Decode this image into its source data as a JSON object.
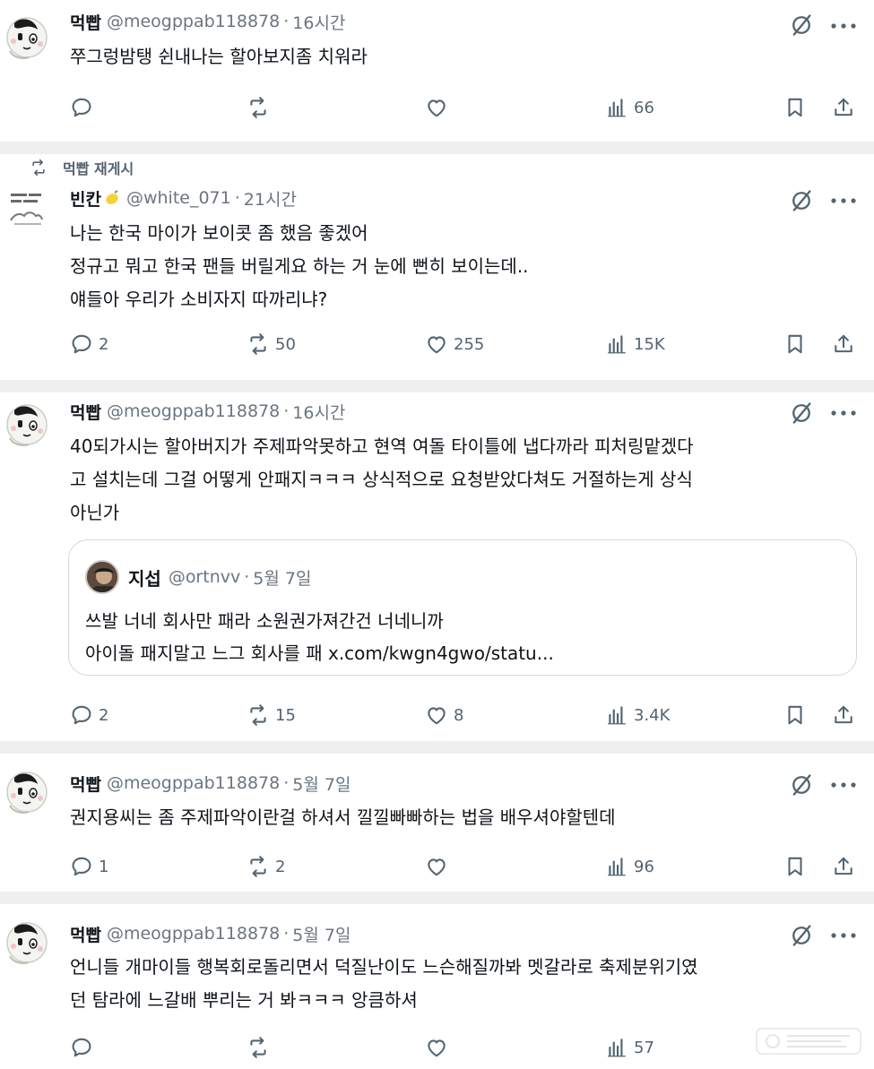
{
  "icons": {
    "reply": "reply-bubble-icon",
    "repost": "repost-arrows-icon",
    "like": "heart-icon",
    "views": "bar-chart-icon",
    "bookmark": "bookmark-icon",
    "share": "share-upload-icon",
    "grok": "grok-slash-icon",
    "more": "ellipsis-icon"
  },
  "colors": {
    "text": "#0f1419",
    "muted": "#536471",
    "separator": "#efefef",
    "quote_border": "#d3d7db"
  },
  "posts": [
    {
      "name": "먹빱",
      "handle": "@meogppab118878",
      "dot": "·",
      "time": "16시간",
      "lines": [
        "쭈그렁밤탱 쉰내나는 할아보지좀 치워라"
      ],
      "replies": "",
      "reposts": "",
      "likes": "",
      "views": "66"
    },
    {
      "repost_label": "먹빱 재게시",
      "name": "빈칸",
      "handle": "@white_071",
      "dot": "·",
      "time": "21시간",
      "lines": [
        "나는 한국 마이가 보이콧 좀 했음 좋겠어",
        "정규고 뭐고 한국 팬들 버릴게요 하는 거 눈에 뻔히 보이는데..",
        "얘들아 우리가 소비자지 따까리냐?"
      ],
      "replies": "2",
      "reposts": "50",
      "likes": "255",
      "views": "15K"
    },
    {
      "name": "먹빱",
      "handle": "@meogppab118878",
      "dot": "·",
      "time": "16시간",
      "lines": [
        "40되가시는 할아버지가 주제파악못하고 현역 여돌 타이틀에 냅다까라 피처링맡겠다",
        "고 설치는데 그걸 어떻게 안패지ㅋㅋㅋ 상식적으로 요청받았다쳐도 거절하는게 상식",
        "아닌가"
      ],
      "quote": {
        "name": "지섭",
        "handle": "@ortnvv",
        "dot": "·",
        "time": "5월 7일",
        "lines": [
          "쓰발 너네 회사만 패라 소원권가져간건 너네니까",
          "아이돌 패지말고 느그 회사를 패 x.com/kwgn4gwo/statu..."
        ]
      },
      "replies": "2",
      "reposts": "15",
      "likes": "8",
      "views": "3.4K"
    },
    {
      "name": "먹빱",
      "handle": "@meogppab118878",
      "dot": "·",
      "time": "5월 7일",
      "lines": [
        "권지용씨는 좀 주제파악이란걸 하셔서 낄낄빠빠하는 법을 배우셔야할텐데"
      ],
      "replies": "1",
      "reposts": "2",
      "likes": "",
      "views": "96"
    },
    {
      "name": "먹빱",
      "handle": "@meogppab118878",
      "dot": "·",
      "time": "5월 7일",
      "lines": [
        "언니들 개마이들 행복회로돌리면서 덕질난이도 느슨해질까봐 멧갈라로 축제분위기였",
        "던 탐라에 느갈배 뿌리는 거 봐ㅋㅋㅋ 앙큼하셔"
      ],
      "replies": "",
      "reposts": "",
      "likes": "",
      "views": "57"
    }
  ]
}
